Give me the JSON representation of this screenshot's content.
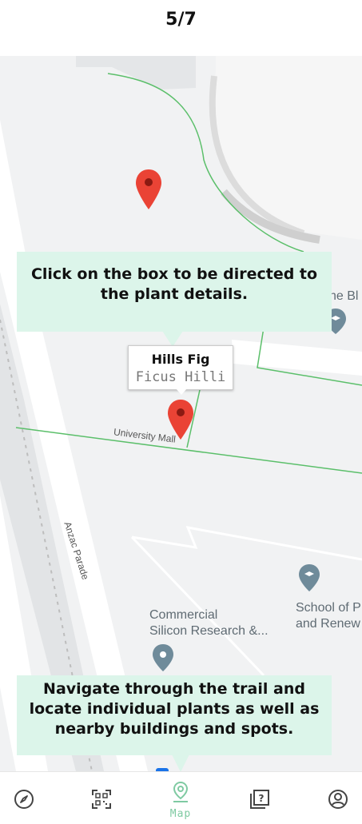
{
  "header": {
    "step": "5/7"
  },
  "tooltips": {
    "box": "Click on the box to be directed to the plant details.",
    "trail": "Navigate through the trail and locate individual plants as well as nearby buildings and spots."
  },
  "map": {
    "info_window": {
      "title": "Hills Fig",
      "subtitle": "Ficus Hilli"
    },
    "road_labels": {
      "university_mall": "University Mall",
      "anzac_parade": "Anzac Parade"
    },
    "place_labels": {
      "commercial": "Commercial\nSilicon Research &...",
      "school": "School of P\nand Renew",
      "partial": "he Bl"
    },
    "colors": {
      "marker": "#ea4335",
      "path": "#5bbf6a",
      "poi": "#6f8b9a"
    }
  },
  "nav": {
    "items": [
      {
        "icon": "compass-icon"
      },
      {
        "icon": "qr-code-icon"
      },
      {
        "icon": "map-pin-icon",
        "label": "Map",
        "active": true
      },
      {
        "icon": "help-book-icon"
      },
      {
        "icon": "profile-icon"
      }
    ]
  }
}
